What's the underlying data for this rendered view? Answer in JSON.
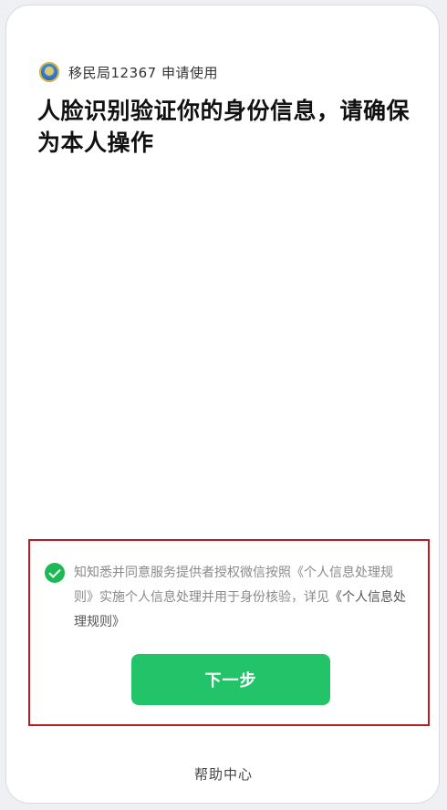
{
  "header": {
    "requester": "移民局12367 申请使用"
  },
  "title": "人脸识别验证你的身份信息，请确保为本人操作",
  "consent": {
    "text": "知知悉并同意服务提供者授权微信按照《个人信息处理规则》实施个人信息处理并用于身份核验，详见",
    "link": "《个人信息处理规则》"
  },
  "next_label": "下一步",
  "help_label": "帮助中心",
  "colors": {
    "primary": "#23c36a",
    "check": "#1db954",
    "highlight_border": "#b71c24"
  }
}
